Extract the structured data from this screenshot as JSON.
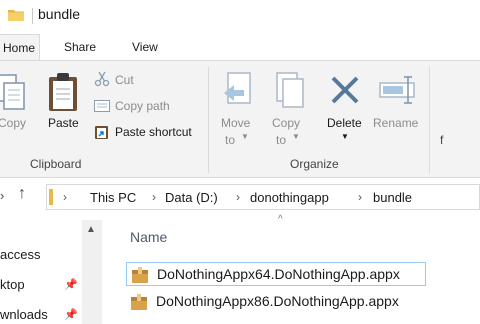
{
  "title": "bundle",
  "tabs": {
    "home": "Home",
    "share": "Share",
    "view": "View"
  },
  "clipboard": {
    "copy": "Copy",
    "paste": "Paste",
    "cut": "Cut",
    "copy_path": "Copy path",
    "paste_shortcut": "Paste shortcut",
    "group": "Clipboard"
  },
  "organize": {
    "move_to_line1": "Move",
    "move_to_line2": "to",
    "copy_to_line1": "Copy",
    "copy_to_line2": "to",
    "delete": "Delete",
    "rename": "Rename",
    "group": "Organize"
  },
  "next_group_partial": "f",
  "address": {
    "crumbs": [
      "This PC",
      "Data (D:)",
      "donothingapp",
      "bundle"
    ]
  },
  "nav": {
    "items": [
      "access",
      "ktop",
      "wnloads"
    ]
  },
  "columns": {
    "name": "Name"
  },
  "files": [
    {
      "name": "DoNothingAppx64.DoNothingApp.appx",
      "selected": true
    },
    {
      "name": "DoNothingAppx86.DoNothingApp.appx",
      "selected": false
    }
  ],
  "colors": {
    "accent": "#0078d7",
    "folder": "#e8b84a",
    "disabled_icon": "#a9b8c9"
  }
}
